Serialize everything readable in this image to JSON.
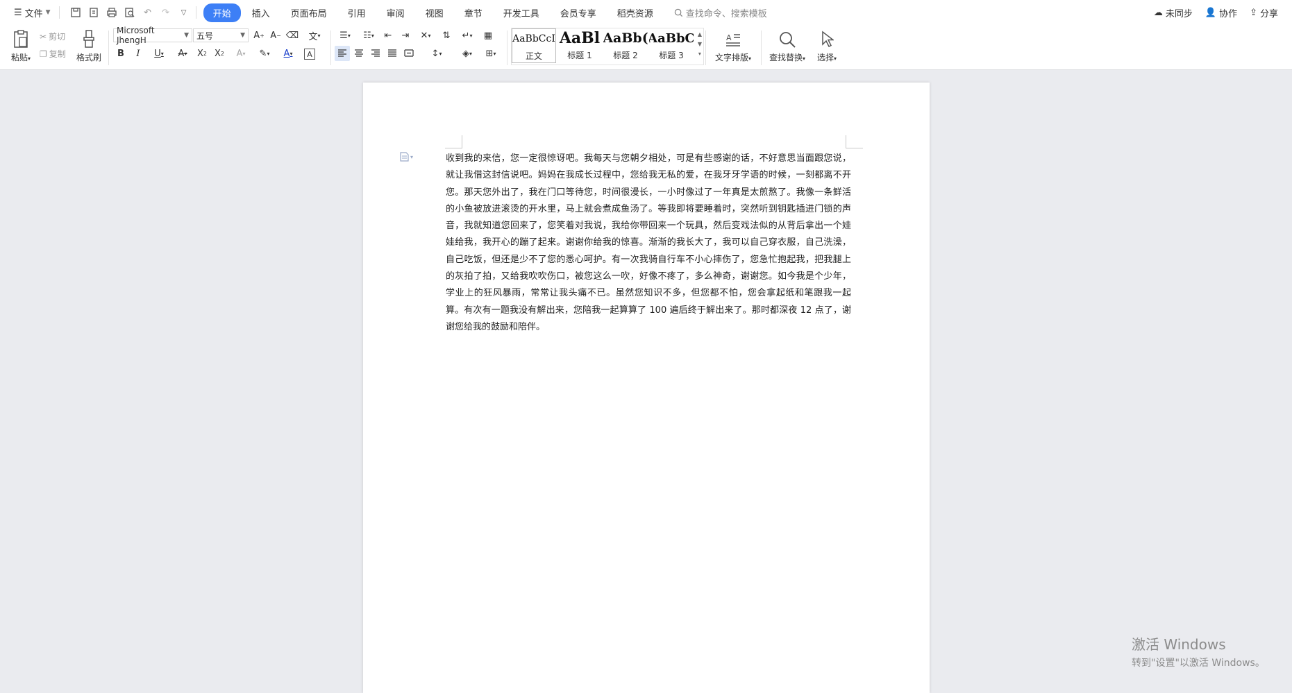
{
  "menubar": {
    "file_label": "文件",
    "tabs": [
      {
        "label": "开始",
        "active": true
      },
      {
        "label": "插入",
        "active": false
      },
      {
        "label": "页面布局",
        "active": false
      },
      {
        "label": "引用",
        "active": false
      },
      {
        "label": "审阅",
        "active": false
      },
      {
        "label": "视图",
        "active": false
      },
      {
        "label": "章节",
        "active": false
      },
      {
        "label": "开发工具",
        "active": false
      },
      {
        "label": "会员专享",
        "active": false
      },
      {
        "label": "稻壳资源",
        "active": false
      }
    ],
    "search_placeholder": "查找命令、搜索模板",
    "sync_label": "未同步",
    "collab_label": "协作",
    "share_label": "分享"
  },
  "ribbon": {
    "paste_label": "粘贴",
    "cut_label": "剪切",
    "copy_label": "复制",
    "format_painter_label": "格式刷",
    "font_name": "Microsoft JhengH",
    "font_size": "五号",
    "styles": [
      {
        "sample": "AaBbCcI",
        "name": "正文"
      },
      {
        "sample": "AaBl",
        "name": "标题 1"
      },
      {
        "sample": "AaBb(",
        "name": "标题 2"
      },
      {
        "sample": "AaBbC",
        "name": "标题 3"
      }
    ],
    "text_layout_label": "文字排版",
    "find_replace_label": "查找替换",
    "select_label": "选择"
  },
  "document": {
    "body": "收到我的来信，您一定很惊讶吧。我每天与您朝夕相处，可是有些感谢的话，不好意思当面跟您说，就让我借这封信说吧。妈妈在我成长过程中，您给我无私的爱，在我牙牙学语的时候，一刻都离不开您。那天您外出了，我在门口等待您，时间很漫长，一小时像过了一年真是太煎熬了。我像一条鲜活的小鱼被放进滚烫的开水里，马上就会煮成鱼汤了。等我即将要睡着时，突然听到钥匙插进门锁的声音，我就知道您回来了，您笑着对我说，我给你带回来一个玩具，然后变戏法似的从背后拿出一个娃娃给我，我开心的蹦了起来。谢谢你给我的惊喜。渐渐的我长大了，我可以自己穿衣服，自己洗澡，自己吃饭，但还是少不了您的悉心呵护。有一次我骑自行车不小心摔伤了，您急忙抱起我，把我腿上的灰拍了拍，又给我吹吹伤口，被您这么一吹，好像不疼了，多么神奇，谢谢您。如今我是个少年，学业上的狂风暴雨，常常让我头痛不已。虽然您知识不多，但您都不怕，您会拿起纸和笔跟我一起算。有次有一题我没有解出来，您陪我一起算算了 100 遍后终于解出来了。那时都深夜 12 点了，谢谢您给我的鼓励和陪伴。"
  },
  "watermark": {
    "line1": "激活 Windows",
    "line2": "转到\"设置\"以激活 Windows。"
  }
}
